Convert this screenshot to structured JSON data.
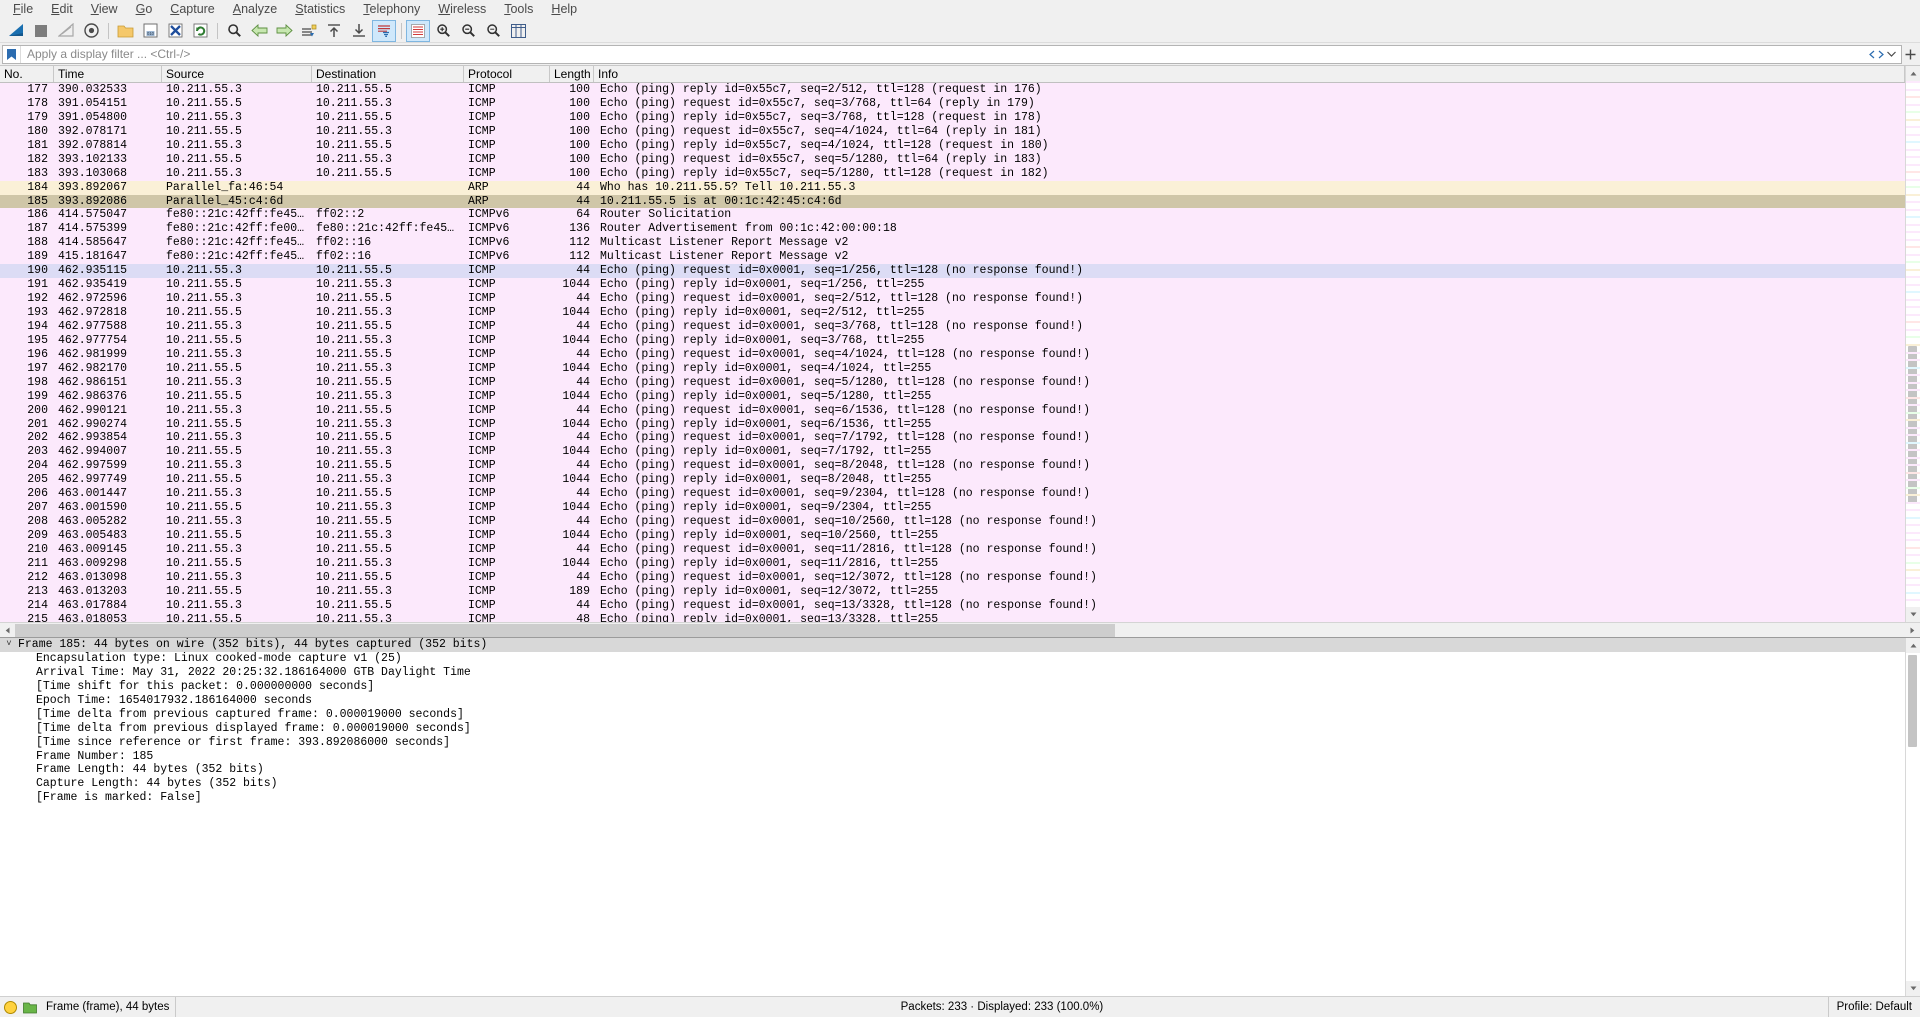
{
  "menu": {
    "items": [
      {
        "label": "File",
        "accel": "F"
      },
      {
        "label": "Edit",
        "accel": "E"
      },
      {
        "label": "View",
        "accel": "V"
      },
      {
        "label": "Go",
        "accel": "G"
      },
      {
        "label": "Capture",
        "accel": "C"
      },
      {
        "label": "Analyze",
        "accel": "A"
      },
      {
        "label": "Statistics",
        "accel": "S"
      },
      {
        "label": "Telephony",
        "accel": "T"
      },
      {
        "label": "Wireless",
        "accel": "W"
      },
      {
        "label": "Tools",
        "accel": "T"
      },
      {
        "label": "Help",
        "accel": "H"
      }
    ]
  },
  "toolbar": {
    "buttons": [
      {
        "name": "start-capture",
        "title": "Start capturing packets"
      },
      {
        "name": "stop-capture",
        "title": "Stop capturing packets"
      },
      {
        "name": "restart-capture",
        "title": "Restart current capture"
      },
      {
        "name": "capture-options",
        "title": "Capture options"
      },
      {
        "name": "open-file",
        "title": "Open a capture file"
      },
      {
        "name": "save-file",
        "title": "Save this capture file"
      },
      {
        "name": "close-file",
        "title": "Close this capture file"
      },
      {
        "name": "reload-file",
        "title": "Reload this file"
      },
      {
        "name": "find-packet",
        "title": "Find a packet"
      },
      {
        "name": "go-back",
        "title": "Go back in packet history"
      },
      {
        "name": "go-forward",
        "title": "Go forward in packet history"
      },
      {
        "name": "go-to-packet",
        "title": "Go to the packet"
      },
      {
        "name": "go-first-packet",
        "title": "Go to the first packet"
      },
      {
        "name": "go-last-packet",
        "title": "Go to the last packet"
      },
      {
        "name": "auto-scroll",
        "title": "Auto scroll in live capture"
      },
      {
        "name": "colorize-packets",
        "title": "Colorize packet list"
      },
      {
        "name": "zoom-in",
        "title": "Zoom in"
      },
      {
        "name": "zoom-out",
        "title": "Zoom out"
      },
      {
        "name": "zoom-reset",
        "title": "Reset zoom level"
      },
      {
        "name": "resize-columns",
        "title": "Resize columns to fit contents"
      }
    ]
  },
  "filter": {
    "placeholder": "Apply a display filter ... <Ctrl-/>",
    "value": ""
  },
  "packet_list": {
    "columns": [
      "No.",
      "Time",
      "Source",
      "Destination",
      "Protocol",
      "Length",
      "Info"
    ],
    "rows": [
      {
        "no": "177",
        "time": "390.032533",
        "src": "10.211.55.3",
        "dst": "10.211.55.5",
        "proto": "ICMP",
        "len": "100",
        "info": "Echo (ping) reply      id=0x55c7, seq=2/512, ttl=128 (request in 176)",
        "style": "r-icmp"
      },
      {
        "no": "178",
        "time": "391.054151",
        "src": "10.211.55.5",
        "dst": "10.211.55.3",
        "proto": "ICMP",
        "len": "100",
        "info": "Echo (ping) request  id=0x55c7, seq=3/768, ttl=64 (reply in 179)",
        "style": "r-icmp"
      },
      {
        "no": "179",
        "time": "391.054800",
        "src": "10.211.55.3",
        "dst": "10.211.55.5",
        "proto": "ICMP",
        "len": "100",
        "info": "Echo (ping) reply      id=0x55c7, seq=3/768, ttl=128 (request in 178)",
        "style": "r-icmp"
      },
      {
        "no": "180",
        "time": "392.078171",
        "src": "10.211.55.5",
        "dst": "10.211.55.3",
        "proto": "ICMP",
        "len": "100",
        "info": "Echo (ping) request  id=0x55c7, seq=4/1024, ttl=64 (reply in 181)",
        "style": "r-icmp"
      },
      {
        "no": "181",
        "time": "392.078814",
        "src": "10.211.55.3",
        "dst": "10.211.55.5",
        "proto": "ICMP",
        "len": "100",
        "info": "Echo (ping) reply      id=0x55c7, seq=4/1024, ttl=128 (request in 180)",
        "style": "r-icmp"
      },
      {
        "no": "182",
        "time": "393.102133",
        "src": "10.211.55.5",
        "dst": "10.211.55.3",
        "proto": "ICMP",
        "len": "100",
        "info": "Echo (ping) request  id=0x55c7, seq=5/1280, ttl=64 (reply in 183)",
        "style": "r-icmp"
      },
      {
        "no": "183",
        "time": "393.103068",
        "src": "10.211.55.3",
        "dst": "10.211.55.5",
        "proto": "ICMP",
        "len": "100",
        "info": "Echo (ping) reply      id=0x55c7, seq=5/1280, ttl=128 (request in 182)",
        "style": "r-icmp"
      },
      {
        "no": "184",
        "time": "393.892067",
        "src": "Parallel_fa:46:54",
        "dst": "",
        "proto": "ARP",
        "len": "44",
        "info": "Who has 10.211.55.5? Tell 10.211.55.3",
        "style": "r-arp"
      },
      {
        "no": "185",
        "time": "393.892086",
        "src": "Parallel_45:c4:6d",
        "dst": "",
        "proto": "ARP",
        "len": "44",
        "info": "10.211.55.5 is at 00:1c:42:45:c4:6d",
        "style": "r-sel"
      },
      {
        "no": "186",
        "time": "414.575047",
        "src": "fe80::21c:42ff:fe45…",
        "dst": "ff02::2",
        "proto": "ICMPv6",
        "len": "64",
        "info": "Router Solicitation",
        "style": "r-icmp"
      },
      {
        "no": "187",
        "time": "414.575399",
        "src": "fe80::21c:42ff:fe00…",
        "dst": "fe80::21c:42ff:fe45…",
        "proto": "ICMPv6",
        "len": "136",
        "info": "Router Advertisement from 00:1c:42:00:00:18",
        "style": "r-icmp"
      },
      {
        "no": "188",
        "time": "414.585647",
        "src": "fe80::21c:42ff:fe45…",
        "dst": "ff02::16",
        "proto": "ICMPv6",
        "len": "112",
        "info": "Multicast Listener Report Message v2",
        "style": "r-icmp"
      },
      {
        "no": "189",
        "time": "415.181647",
        "src": "fe80::21c:42ff:fe45…",
        "dst": "ff02::16",
        "proto": "ICMPv6",
        "len": "112",
        "info": "Multicast Listener Report Message v2",
        "style": "r-icmp"
      },
      {
        "no": "190",
        "time": "462.935115",
        "src": "10.211.55.3",
        "dst": "10.211.55.5",
        "proto": "ICMP",
        "len": "44",
        "info": "Echo (ping) request  id=0x0001, seq=1/256, ttl=128 (no response found!)",
        "style": "r-hl"
      },
      {
        "no": "191",
        "time": "462.935419",
        "src": "10.211.55.5",
        "dst": "10.211.55.3",
        "proto": "ICMP",
        "len": "1044",
        "info": "Echo (ping) reply      id=0x0001, seq=1/256, ttl=255",
        "style": "r-icmp"
      },
      {
        "no": "192",
        "time": "462.972596",
        "src": "10.211.55.3",
        "dst": "10.211.55.5",
        "proto": "ICMP",
        "len": "44",
        "info": "Echo (ping) request  id=0x0001, seq=2/512, ttl=128 (no response found!)",
        "style": "r-icmp"
      },
      {
        "no": "193",
        "time": "462.972818",
        "src": "10.211.55.5",
        "dst": "10.211.55.3",
        "proto": "ICMP",
        "len": "1044",
        "info": "Echo (ping) reply      id=0x0001, seq=2/512, ttl=255",
        "style": "r-icmp"
      },
      {
        "no": "194",
        "time": "462.977588",
        "src": "10.211.55.3",
        "dst": "10.211.55.5",
        "proto": "ICMP",
        "len": "44",
        "info": "Echo (ping) request  id=0x0001, seq=3/768, ttl=128 (no response found!)",
        "style": "r-icmp"
      },
      {
        "no": "195",
        "time": "462.977754",
        "src": "10.211.55.5",
        "dst": "10.211.55.3",
        "proto": "ICMP",
        "len": "1044",
        "info": "Echo (ping) reply      id=0x0001, seq=3/768, ttl=255",
        "style": "r-icmp"
      },
      {
        "no": "196",
        "time": "462.981999",
        "src": "10.211.55.3",
        "dst": "10.211.55.5",
        "proto": "ICMP",
        "len": "44",
        "info": "Echo (ping) request  id=0x0001, seq=4/1024, ttl=128 (no response found!)",
        "style": "r-icmp"
      },
      {
        "no": "197",
        "time": "462.982170",
        "src": "10.211.55.5",
        "dst": "10.211.55.3",
        "proto": "ICMP",
        "len": "1044",
        "info": "Echo (ping) reply      id=0x0001, seq=4/1024, ttl=255",
        "style": "r-icmp"
      },
      {
        "no": "198",
        "time": "462.986151",
        "src": "10.211.55.3",
        "dst": "10.211.55.5",
        "proto": "ICMP",
        "len": "44",
        "info": "Echo (ping) request  id=0x0001, seq=5/1280, ttl=128 (no response found!)",
        "style": "r-icmp"
      },
      {
        "no": "199",
        "time": "462.986376",
        "src": "10.211.55.5",
        "dst": "10.211.55.3",
        "proto": "ICMP",
        "len": "1044",
        "info": "Echo (ping) reply      id=0x0001, seq=5/1280, ttl=255",
        "style": "r-icmp"
      },
      {
        "no": "200",
        "time": "462.990121",
        "src": "10.211.55.3",
        "dst": "10.211.55.5",
        "proto": "ICMP",
        "len": "44",
        "info": "Echo (ping) request  id=0x0001, seq=6/1536, ttl=128 (no response found!)",
        "style": "r-icmp"
      },
      {
        "no": "201",
        "time": "462.990274",
        "src": "10.211.55.5",
        "dst": "10.211.55.3",
        "proto": "ICMP",
        "len": "1044",
        "info": "Echo (ping) reply      id=0x0001, seq=6/1536, ttl=255",
        "style": "r-icmp"
      },
      {
        "no": "202",
        "time": "462.993854",
        "src": "10.211.55.3",
        "dst": "10.211.55.5",
        "proto": "ICMP",
        "len": "44",
        "info": "Echo (ping) request  id=0x0001, seq=7/1792, ttl=128 (no response found!)",
        "style": "r-icmp"
      },
      {
        "no": "203",
        "time": "462.994007",
        "src": "10.211.55.5",
        "dst": "10.211.55.3",
        "proto": "ICMP",
        "len": "1044",
        "info": "Echo (ping) reply      id=0x0001, seq=7/1792, ttl=255",
        "style": "r-icmp"
      },
      {
        "no": "204",
        "time": "462.997599",
        "src": "10.211.55.3",
        "dst": "10.211.55.5",
        "proto": "ICMP",
        "len": "44",
        "info": "Echo (ping) request  id=0x0001, seq=8/2048, ttl=128 (no response found!)",
        "style": "r-icmp"
      },
      {
        "no": "205",
        "time": "462.997749",
        "src": "10.211.55.5",
        "dst": "10.211.55.3",
        "proto": "ICMP",
        "len": "1044",
        "info": "Echo (ping) reply      id=0x0001, seq=8/2048, ttl=255",
        "style": "r-icmp"
      },
      {
        "no": "206",
        "time": "463.001447",
        "src": "10.211.55.3",
        "dst": "10.211.55.5",
        "proto": "ICMP",
        "len": "44",
        "info": "Echo (ping) request  id=0x0001, seq=9/2304, ttl=128 (no response found!)",
        "style": "r-icmp"
      },
      {
        "no": "207",
        "time": "463.001590",
        "src": "10.211.55.5",
        "dst": "10.211.55.3",
        "proto": "ICMP",
        "len": "1044",
        "info": "Echo (ping) reply      id=0x0001, seq=9/2304, ttl=255",
        "style": "r-icmp"
      },
      {
        "no": "208",
        "time": "463.005282",
        "src": "10.211.55.3",
        "dst": "10.211.55.5",
        "proto": "ICMP",
        "len": "44",
        "info": "Echo (ping) request  id=0x0001, seq=10/2560, ttl=128 (no response found!)",
        "style": "r-icmp"
      },
      {
        "no": "209",
        "time": "463.005483",
        "src": "10.211.55.5",
        "dst": "10.211.55.3",
        "proto": "ICMP",
        "len": "1044",
        "info": "Echo (ping) reply      id=0x0001, seq=10/2560, ttl=255",
        "style": "r-icmp"
      },
      {
        "no": "210",
        "time": "463.009145",
        "src": "10.211.55.3",
        "dst": "10.211.55.5",
        "proto": "ICMP",
        "len": "44",
        "info": "Echo (ping) request  id=0x0001, seq=11/2816, ttl=128 (no response found!)",
        "style": "r-icmp"
      },
      {
        "no": "211",
        "time": "463.009298",
        "src": "10.211.55.5",
        "dst": "10.211.55.3",
        "proto": "ICMP",
        "len": "1044",
        "info": "Echo (ping) reply      id=0x0001, seq=11/2816, ttl=255",
        "style": "r-icmp"
      },
      {
        "no": "212",
        "time": "463.013098",
        "src": "10.211.55.3",
        "dst": "10.211.55.5",
        "proto": "ICMP",
        "len": "44",
        "info": "Echo (ping) request  id=0x0001, seq=12/3072, ttl=128 (no response found!)",
        "style": "r-icmp"
      },
      {
        "no": "213",
        "time": "463.013203",
        "src": "10.211.55.5",
        "dst": "10.211.55.3",
        "proto": "ICMP",
        "len": "189",
        "info": "Echo (ping) reply      id=0x0001, seq=12/3072, ttl=255",
        "style": "r-icmp"
      },
      {
        "no": "214",
        "time": "463.017884",
        "src": "10.211.55.3",
        "dst": "10.211.55.5",
        "proto": "ICMP",
        "len": "44",
        "info": "Echo (ping) request  id=0x0001, seq=13/3328, ttl=128 (no response found!)",
        "style": "r-icmp"
      },
      {
        "no": "215",
        "time": "463.018053",
        "src": "10.211.55.5",
        "dst": "10.211.55.3",
        "proto": "ICMP",
        "len": "48",
        "info": "Echo (ping) reply      id=0x0001, seq=13/3328, ttl=255",
        "style": "r-icmp"
      }
    ]
  },
  "detail": {
    "lines": [
      {
        "text": "Frame 185: 44 bytes on wire (352 bits), 44 bytes captured (352 bits)",
        "root": true,
        "twisty": "˅"
      },
      {
        "text": "Encapsulation type: Linux cooked-mode capture v1 (25)",
        "root": false
      },
      {
        "text": "Arrival Time: May 31, 2022 20:25:32.186164000 GTB Daylight Time",
        "root": false
      },
      {
        "text": "[Time shift for this packet: 0.000000000 seconds]",
        "root": false
      },
      {
        "text": "Epoch Time: 1654017932.186164000 seconds",
        "root": false
      },
      {
        "text": "[Time delta from previous captured frame: 0.000019000 seconds]",
        "root": false
      },
      {
        "text": "[Time delta from previous displayed frame: 0.000019000 seconds]",
        "root": false
      },
      {
        "text": "[Time since reference or first frame: 393.892086000 seconds]",
        "root": false
      },
      {
        "text": "Frame Number: 185",
        "root": false
      },
      {
        "text": "Frame Length: 44 bytes (352 bits)",
        "root": false
      },
      {
        "text": "Capture Length: 44 bytes (352 bits)",
        "root": false
      },
      {
        "text": "[Frame is marked: False]",
        "root": false
      }
    ]
  },
  "statusbar": {
    "field": "Frame (frame), 44 bytes",
    "packets": "Packets: 233 · Displayed: 233 (100.0%)",
    "profile": "Profile: Default"
  },
  "colors": {
    "icmp_row": "#fce9fc",
    "arp_row": "#faf0d7",
    "selected_row": "#cfc6a8",
    "related_row": "#dcdcf5",
    "detail_root": "#d8d8d8",
    "chrome": "#f0f0f0",
    "expert_dot": "#ffd23f"
  },
  "scroll": {
    "h_position_percent": 0,
    "v_position_percent": 72
  }
}
